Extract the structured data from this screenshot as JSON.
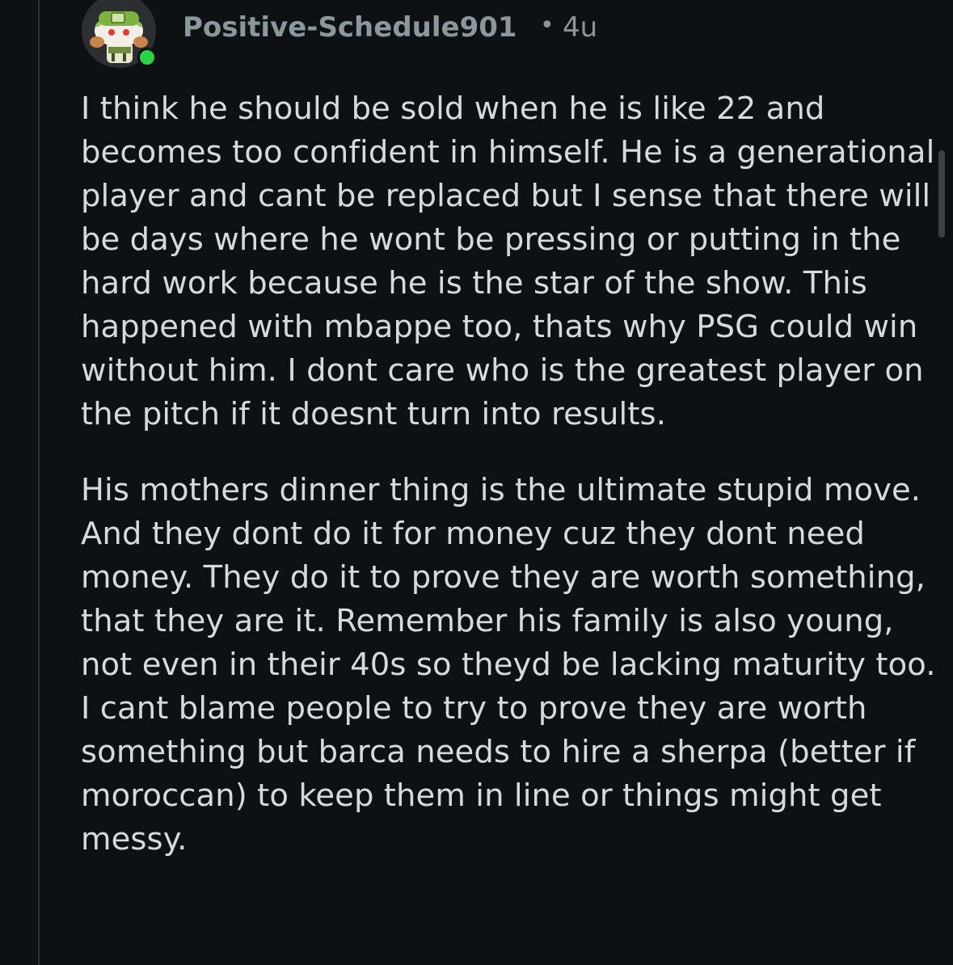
{
  "comment": {
    "author": "Positive-Schedule901",
    "separator": "•",
    "timestamp": "4u",
    "online": true,
    "paragraphs": [
      "I think he should be sold when he is like 22 and becomes too confident in himself. He is a generational player and cant be replaced but I sense that there will be days where he wont be pressing or putting in the hard work because he is the star of the show. This happened with mbappe too, thats why PSG could win without him. I dont care who is the greatest player on the pitch if it doesnt turn into results.",
      "His mothers dinner thing is the ultimate stupid move. And they dont do it for money cuz they dont need money. They do it to prove they are worth something, that they are it. Remember his family is also young, not even in their 40s so theyd be lacking maturity too. I cant blame people to try to prove they are worth something but barca needs to hire a sherpa (better if moroccan) to keep them in line or things might get messy."
    ]
  },
  "colors": {
    "background": "#0e1113",
    "text": "#d7dadc",
    "meta": "#8a979d",
    "online_dot": "#2ad34a",
    "thread_line": "#2a3236"
  },
  "icons": {
    "avatar": "snoo-avatar-green-bandana",
    "online": "online-status-dot"
  }
}
